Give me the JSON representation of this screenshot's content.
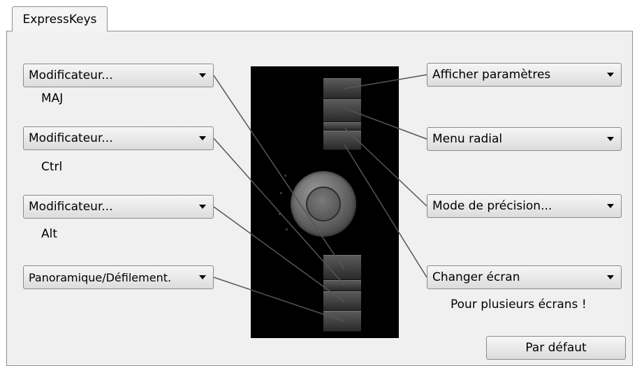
{
  "tab": {
    "label": "ExpressKeys"
  },
  "left_keys": [
    {
      "value": "Modificateur...",
      "sub": "MAJ"
    },
    {
      "value": "Modificateur...",
      "sub": "Ctrl"
    },
    {
      "value": "Modificateur...",
      "sub": "Alt"
    },
    {
      "value": "Panoramique/Défilement.",
      "sub": ""
    }
  ],
  "right_keys": [
    {
      "value": "Afficher paramètres"
    },
    {
      "value": "Menu radial"
    },
    {
      "value": "Mode de précision..."
    },
    {
      "value": "Changer écran",
      "sub": "Pour plusieurs écrans !"
    }
  ],
  "default_button": "Par défaut",
  "colors": {
    "device": "#000000",
    "leader_lines": "#555555"
  }
}
